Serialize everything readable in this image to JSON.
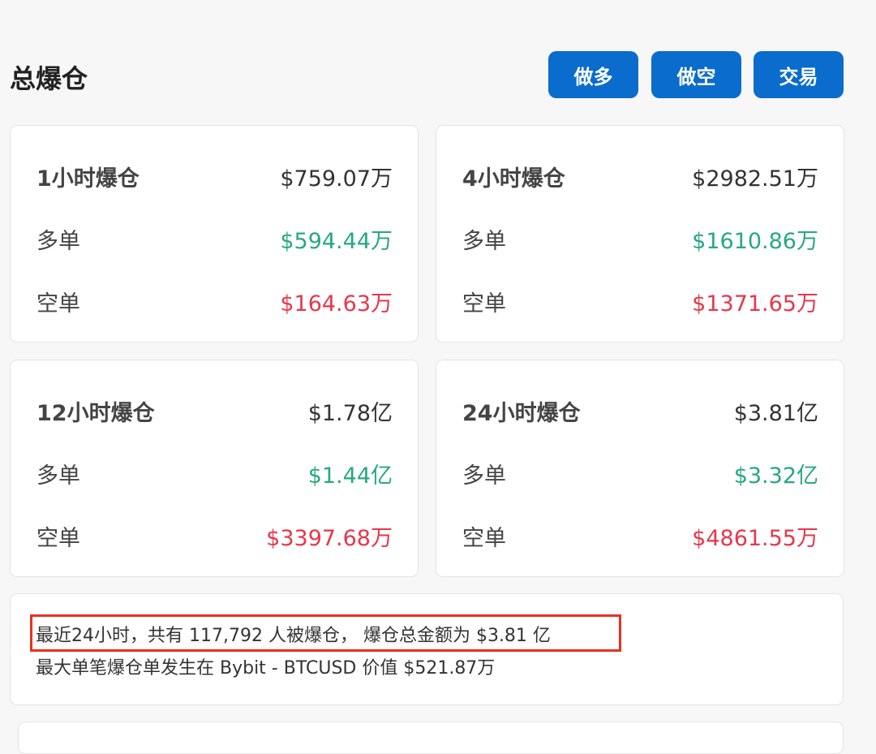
{
  "header": {
    "title": "总爆仓",
    "buttons": [
      "做多",
      "做空",
      "交易"
    ]
  },
  "cards": [
    {
      "label": "1小时爆仓",
      "total": "$759.07万",
      "long_label": "多单",
      "long": "$594.44万",
      "short_label": "空单",
      "short": "$164.63万"
    },
    {
      "label": "4小时爆仓",
      "total": "$2982.51万",
      "long_label": "多单",
      "long": "$1610.86万",
      "short_label": "空单",
      "short": "$1371.65万"
    },
    {
      "label": "12小时爆仓",
      "total": "$1.78亿",
      "long_label": "多单",
      "long": "$1.44亿",
      "short_label": "空单",
      "short": "$3397.68万"
    },
    {
      "label": "24小时爆仓",
      "total": "$3.81亿",
      "long_label": "多单",
      "long": "$3.32亿",
      "short_label": "空单",
      "short": "$4861.55万"
    }
  ],
  "summary": {
    "line1": "最近24小时，共有 117,792 人被爆仓， 爆仓总金额为 $3.81 亿",
    "line2": "最大单笔爆仓单发生在 Bybit - BTCUSD 价值 $521.87万"
  },
  "colors": {
    "accent": "#0a6ccc",
    "long": "#27a882",
    "short": "#e8364b",
    "highlight": "#e8321e"
  }
}
